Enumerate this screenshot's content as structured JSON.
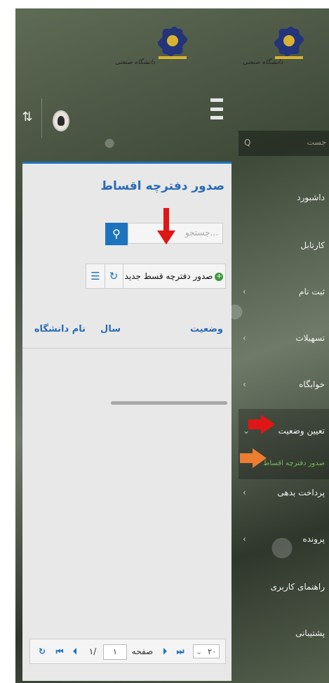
{
  "header": {
    "logo_text": "دانشگاه صنعتی",
    "menu_icon": "hamburger-icon",
    "filter_icon": "sliders-icon"
  },
  "sidebar": {
    "search_placeholder": "جست",
    "items": [
      {
        "label": "داشبورد",
        "chevron": false
      },
      {
        "label": "کارتابل",
        "chevron": false
      },
      {
        "label": "ثبت نام",
        "chevron": true
      },
      {
        "label": "تسهیلات",
        "chevron": true
      },
      {
        "label": "خوابگاه",
        "chevron": true
      },
      {
        "label": "تعیین وضعیت",
        "chevron": true
      },
      {
        "label": "پرداخت بدهی",
        "chevron": true
      },
      {
        "label": "پرونده",
        "chevron": true
      },
      {
        "label": "راهنمای کاربری",
        "chevron": false
      },
      {
        "label": "پشتیبانی",
        "chevron": false
      }
    ],
    "active_sub_item": "صدور دفترچه اقساط"
  },
  "main": {
    "title": "صدور دفترچه اقساط",
    "search_placeholder": "جستجو...",
    "new_button_label": "صدور دفترچه قسط جدید",
    "columns": [
      "وضعیت",
      "سال",
      "نام دانشگاه"
    ],
    "rows": []
  },
  "pager": {
    "page_size": "۲۰",
    "page_label": "صفحه",
    "current_page": "۱",
    "total_pages": "۱/"
  },
  "colors": {
    "accent": "#1e73be",
    "arrow_red": "#e01616",
    "arrow_orange": "#ec7c30",
    "sub_item_green": "#6fc05b"
  }
}
